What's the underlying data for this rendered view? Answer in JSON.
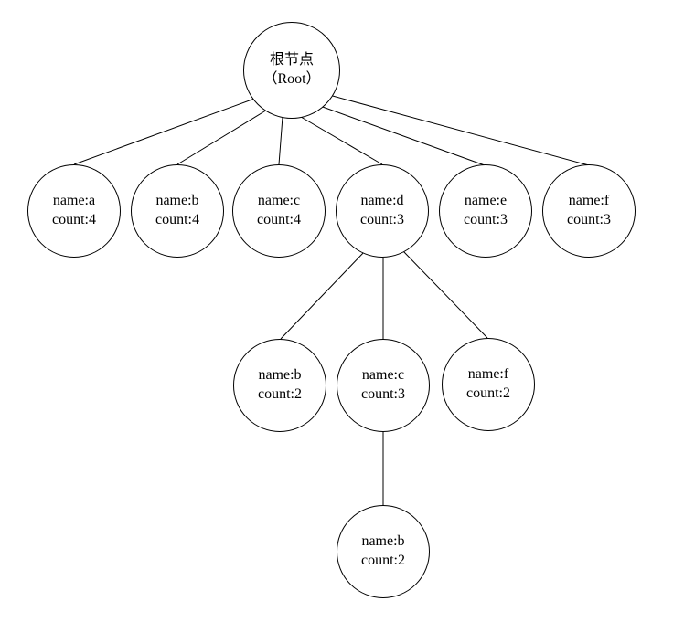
{
  "root": {
    "line1": "根节点",
    "line2": "（Root）"
  },
  "level1": [
    {
      "name": "name:a",
      "count": "count:4"
    },
    {
      "name": "name:b",
      "count": "count:4"
    },
    {
      "name": "name:c",
      "count": "count:4"
    },
    {
      "name": "name:d",
      "count": "count:3"
    },
    {
      "name": "name:e",
      "count": "count:3"
    },
    {
      "name": "name:f",
      "count": "count:3"
    }
  ],
  "level2": [
    {
      "name": "name:b",
      "count": "count:2"
    },
    {
      "name": "name:c",
      "count": "count:3"
    },
    {
      "name": "name:f",
      "count": "count:2"
    }
  ],
  "level3": [
    {
      "name": "name:b",
      "count": "count:2"
    }
  ]
}
